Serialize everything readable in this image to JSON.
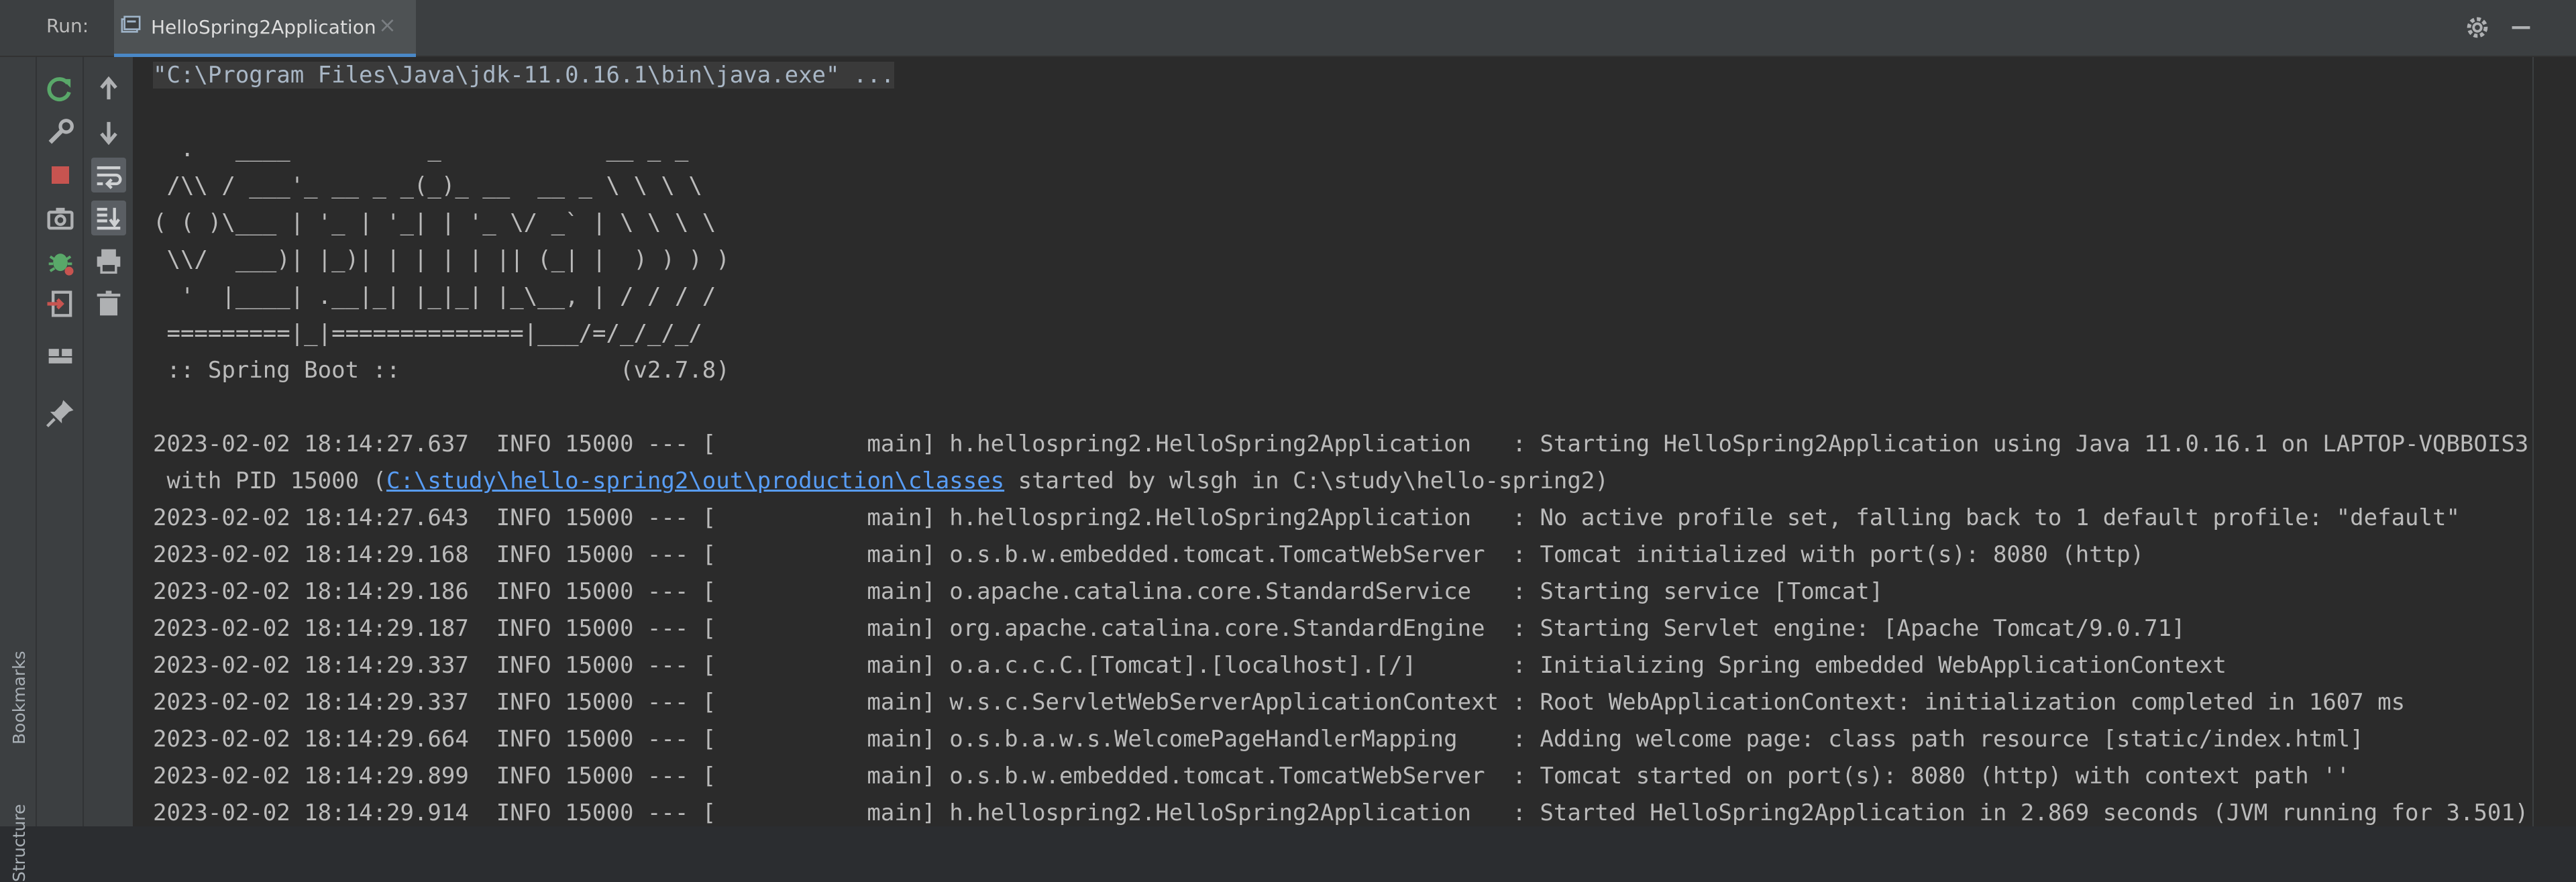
{
  "run_bar": {
    "label": "Run:",
    "tab_title": "HelloSpring2Application",
    "close_glyph": "×"
  },
  "left_strip": {
    "bookmarks": "Bookmarks",
    "structure": "Structure"
  },
  "toolbar": {
    "left_column": [
      "rerun-icon",
      "edit-configuration-icon",
      "stop-icon",
      "camera-icon",
      "debug-icon",
      "exit-icon",
      "layout-icon",
      "pin-icon"
    ],
    "right_column": [
      "scroll-up-icon",
      "scroll-down-icon",
      "soft-wrap-icon",
      "scroll-to-end-icon",
      "print-icon",
      "clear-all-icon"
    ]
  },
  "console": {
    "command": "\"C:\\Program Files\\Java\\jdk-11.0.16.1\\bin\\java.exe\" ...",
    "banner": [
      "  .   ____          _            __ _ _",
      " /\\\\ / ___'_ __ _ _(_)_ __  __ _ \\ \\ \\ \\",
      "( ( )\\___ | '_ | '_| | '_ \\/ _` | \\ \\ \\ \\",
      " \\\\/  ___)| |_)| | | | | || (_| |  ) ) ) )",
      "  '  |____| .__|_| |_|_| |_\\__, | / / / /",
      " =========|_|==============|___/=/_/_/_/",
      " :: Spring Boot ::                (v2.7.8)"
    ],
    "log": [
      {
        "text": "2023-02-02 18:14:27.637  INFO 15000 --- [           main] h.hellospring2.HelloSpring2Application   : Starting HelloSpring2Application using Java 11.0.16.1 on LAPTOP-VQBBOIS3"
      },
      {
        "prefix": " with PID 15000 (",
        "link": "C:\\study\\hello-spring2\\out\\production\\classes",
        "suffix": " started by wlsgh in C:\\study\\hello-spring2)"
      },
      {
        "text": "2023-02-02 18:14:27.643  INFO 15000 --- [           main] h.hellospring2.HelloSpring2Application   : No active profile set, falling back to 1 default profile: \"default\""
      },
      {
        "text": "2023-02-02 18:14:29.168  INFO 15000 --- [           main] o.s.b.w.embedded.tomcat.TomcatWebServer  : Tomcat initialized with port(s): 8080 (http)"
      },
      {
        "text": "2023-02-02 18:14:29.186  INFO 15000 --- [           main] o.apache.catalina.core.StandardService   : Starting service [Tomcat]"
      },
      {
        "text": "2023-02-02 18:14:29.187  INFO 15000 --- [           main] org.apache.catalina.core.StandardEngine  : Starting Servlet engine: [Apache Tomcat/9.0.71]"
      },
      {
        "text": "2023-02-02 18:14:29.337  INFO 15000 --- [           main] o.a.c.c.C.[Tomcat].[localhost].[/]       : Initializing Spring embedded WebApplicationContext"
      },
      {
        "text": "2023-02-02 18:14:29.337  INFO 15000 --- [           main] w.s.c.ServletWebServerApplicationContext : Root WebApplicationContext: initialization completed in 1607 ms"
      },
      {
        "text": "2023-02-02 18:14:29.664  INFO 15000 --- [           main] o.s.b.a.w.s.WelcomePageHandlerMapping    : Adding welcome page: class path resource [static/index.html]"
      },
      {
        "text": "2023-02-02 18:14:29.899  INFO 15000 --- [           main] o.s.b.w.embedded.tomcat.TomcatWebServer  : Tomcat started on port(s): 8080 (http) with context path ''"
      },
      {
        "text": "2023-02-02 18:14:29.914  INFO 15000 --- [           main] h.hellospring2.HelloSpring2Application   : Started HelloSpring2Application in 2.869 seconds (JVM running for 3.501)"
      }
    ]
  },
  "colors": {
    "toolwindow_bg": "#3c3f41",
    "console_bg": "#2b2b2b",
    "console_text": "#bbbbbb",
    "link": "#589df6",
    "rerun_green": "#59a869",
    "stop_red": "#c75450",
    "tab_underline": "#4a88c7"
  }
}
